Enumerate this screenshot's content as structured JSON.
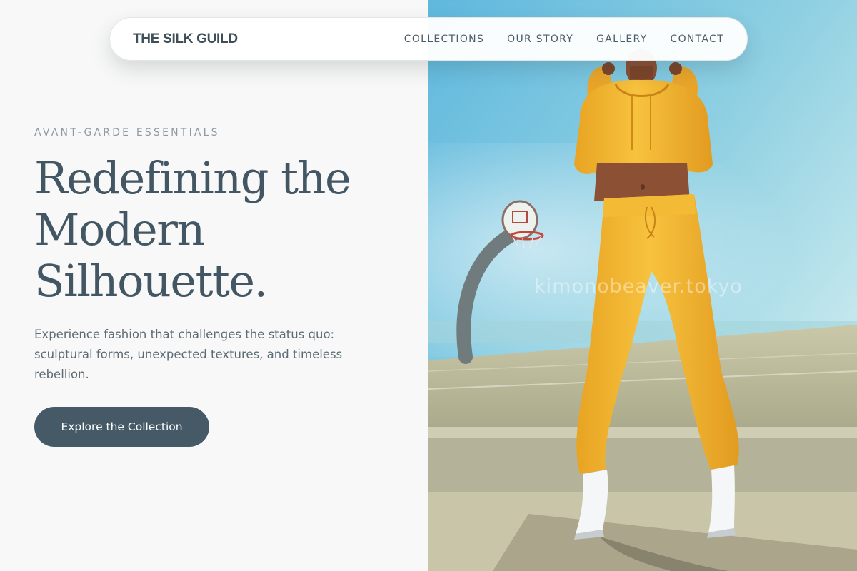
{
  "brand": {
    "name": "THE SILK GUILD"
  },
  "nav": {
    "links": [
      {
        "label": "COLLECTIONS"
      },
      {
        "label": "OUR STORY"
      },
      {
        "label": "GALLERY"
      },
      {
        "label": "CONTACT"
      }
    ]
  },
  "hero": {
    "eyebrow": "AVANT-GARDE ESSENTIALS",
    "headline_lines": [
      "Redefining the",
      "Modern",
      "Silhouette."
    ],
    "description": "Experience fashion that challenges the status quo: sculptural forms, unexpected textures, and timeless rebellion.",
    "cta_label": "Explore the Collection"
  },
  "image": {
    "subject": "model in yellow cropped hoodie and joggers with white boots on basketball court",
    "watermark": "kimonobeaver.tokyo"
  },
  "colors": {
    "accent": "#455a66",
    "headline": "#435663",
    "outfit": "#f2b230",
    "sky": "#6cc0e0"
  }
}
